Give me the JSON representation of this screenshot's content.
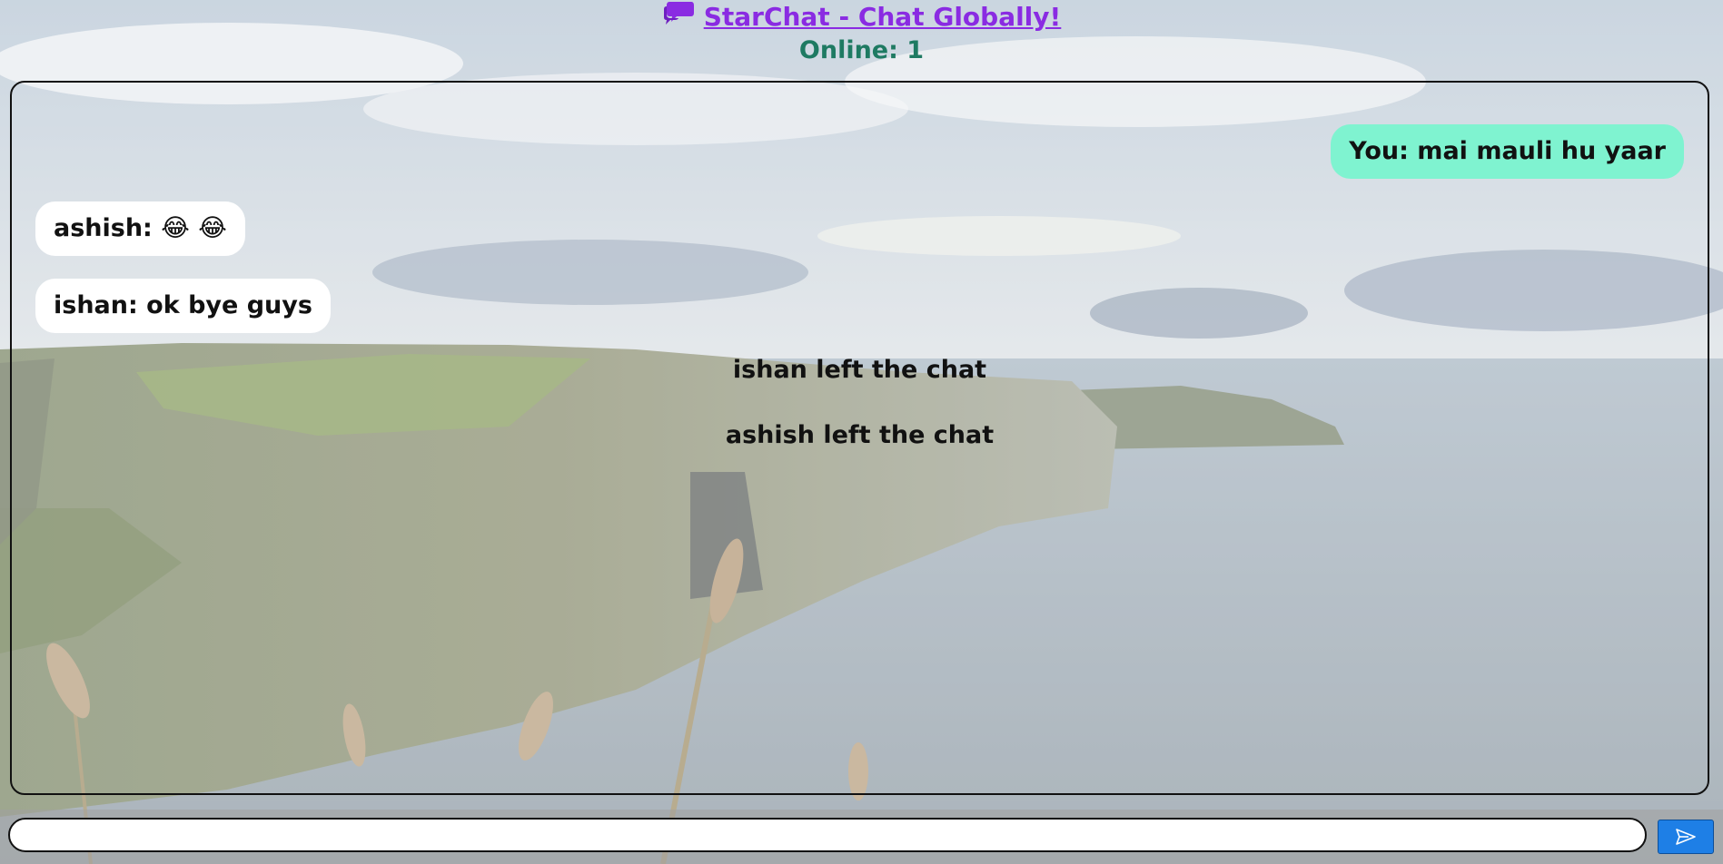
{
  "header": {
    "title": "StarChat - Chat Globally!",
    "online_label": "Online: 1",
    "logo_icon": "chat-bubble-icon",
    "title_color": "#8a2be2",
    "online_color": "#1e7a62"
  },
  "chat": {
    "messages": [
      {
        "type": "self",
        "text": "You: mai mauli hu yaar",
        "bg": "#7ff3d0"
      },
      {
        "type": "other",
        "text": "ashish: 😂 😂",
        "bg": "#ffffff"
      },
      {
        "type": "other",
        "text": "ishan: ok bye guys",
        "bg": "#ffffff"
      }
    ],
    "system": [
      "ishan left the chat",
      "ashish left the chat"
    ]
  },
  "composer": {
    "input_value": "",
    "send_icon": "send-arrow-icon",
    "send_color": "#1e7fe6"
  }
}
